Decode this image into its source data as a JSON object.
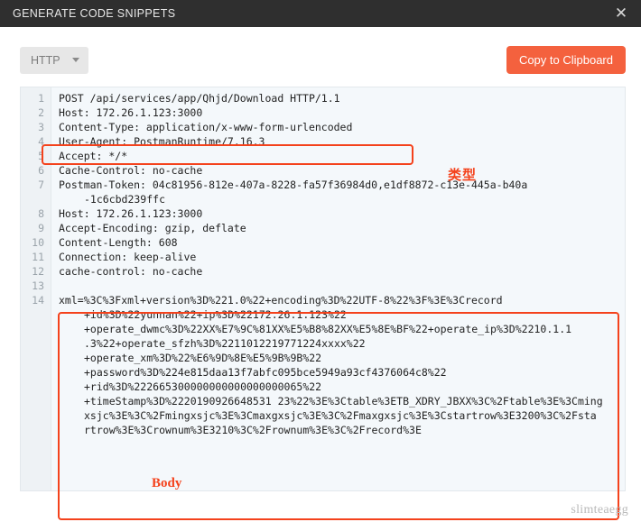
{
  "header": {
    "title": "GENERATE CODE SNIPPETS",
    "close_icon": "close-icon",
    "close_glyph": "✕",
    "bg_color": "#2f2f2f"
  },
  "toolbar": {
    "language_selected": "HTTP",
    "language_caret_icon": "chevron-down-icon",
    "copy_label": "Copy to Clipboard",
    "copy_color": "#f4613e"
  },
  "code": {
    "gutter_numbers": [
      "1",
      "2",
      "3",
      "4",
      "5",
      "6",
      "7",
      "",
      "8",
      "9",
      "10",
      "11",
      "12",
      "13",
      "14"
    ],
    "lines": [
      {
        "num": "1",
        "text": "POST /api/services/app/Qhjd/Download HTTP/1.1",
        "indent": false
      },
      {
        "num": "2",
        "text": "Host: 172.26.1.123:3000",
        "indent": false
      },
      {
        "num": "3",
        "text": "Content-Type: application/x-www-form-urlencoded",
        "indent": false
      },
      {
        "num": "4",
        "text": "User-Agent: PostmanRuntime/7.16.3",
        "indent": false
      },
      {
        "num": "5",
        "text": "Accept: */*",
        "indent": false
      },
      {
        "num": "6",
        "text": "Cache-Control: no-cache",
        "indent": false
      },
      {
        "num": "7",
        "text": "Postman-Token: 04c81956-812e-407a-8228-fa57f36984d0,e1df8872-c13e-445a-b40a",
        "indent": false
      },
      {
        "num": "",
        "text": "-1c6cbd239ffc",
        "indent": true
      },
      {
        "num": "8",
        "text": "Host: 172.26.1.123:3000",
        "indent": false
      },
      {
        "num": "9",
        "text": "Accept-Encoding: gzip, deflate",
        "indent": false
      },
      {
        "num": "10",
        "text": "Content-Length: 608",
        "indent": false
      },
      {
        "num": "11",
        "text": "Connection: keep-alive",
        "indent": false
      },
      {
        "num": "12",
        "text": "cache-control: no-cache",
        "indent": false
      },
      {
        "num": "13",
        "text": "",
        "indent": false
      },
      {
        "num": "14",
        "text": "xml=%3C%3Fxml+version%3D%221.0%22+encoding%3D%22UTF-8%22%3F%3E%3Crecord",
        "indent": false
      },
      {
        "num": "",
        "text": "+id%3D%22yunnan%22+ip%3D%22172.26.1.123%22",
        "indent": true
      },
      {
        "num": "",
        "text": "+operate_dwmc%3D%22XX%E7%9C%81XX%E5%B8%82XX%E5%8E%BF%22+operate_ip%3D%2210.1.1",
        "indent": true
      },
      {
        "num": "",
        "text": ".3%22+operate_sfzh%3D%2211012219771224xxxx%22",
        "indent": true
      },
      {
        "num": "",
        "text": "+operate_xm%3D%22%E6%9D%8E%E5%9B%9B%22",
        "indent": true
      },
      {
        "num": "",
        "text": "+password%3D%224e815daa13f7abfc095bce5949a93cf4376064c8%22",
        "indent": true
      },
      {
        "num": "",
        "text": "+rid%3D%222665300000000000000000065%22",
        "indent": true
      },
      {
        "num": "",
        "text": "+timeStamp%3D%2220190926648531 23%22%3E%3Ctable%3ETB_XDRY_JBXX%3C%2Ftable%3E%3Cming",
        "indent": true
      },
      {
        "num": "",
        "text": "xsjc%3E%3C%2Fmingxsjc%3E%3Cmaxgxsjc%3E%3C%2Fmaxgxsjc%3E%3Cstartrow%3E3200%3C%2Fsta",
        "indent": true
      },
      {
        "num": "",
        "text": "rtrow%3E%3Crownum%3E3210%3C%2Frownum%3E%3C%2Frecord%3E",
        "indent": true
      }
    ]
  },
  "annotations": {
    "content_type_label": "类型",
    "body_label": "Body",
    "color": "#f4421c"
  },
  "watermark": "slimteaegg"
}
